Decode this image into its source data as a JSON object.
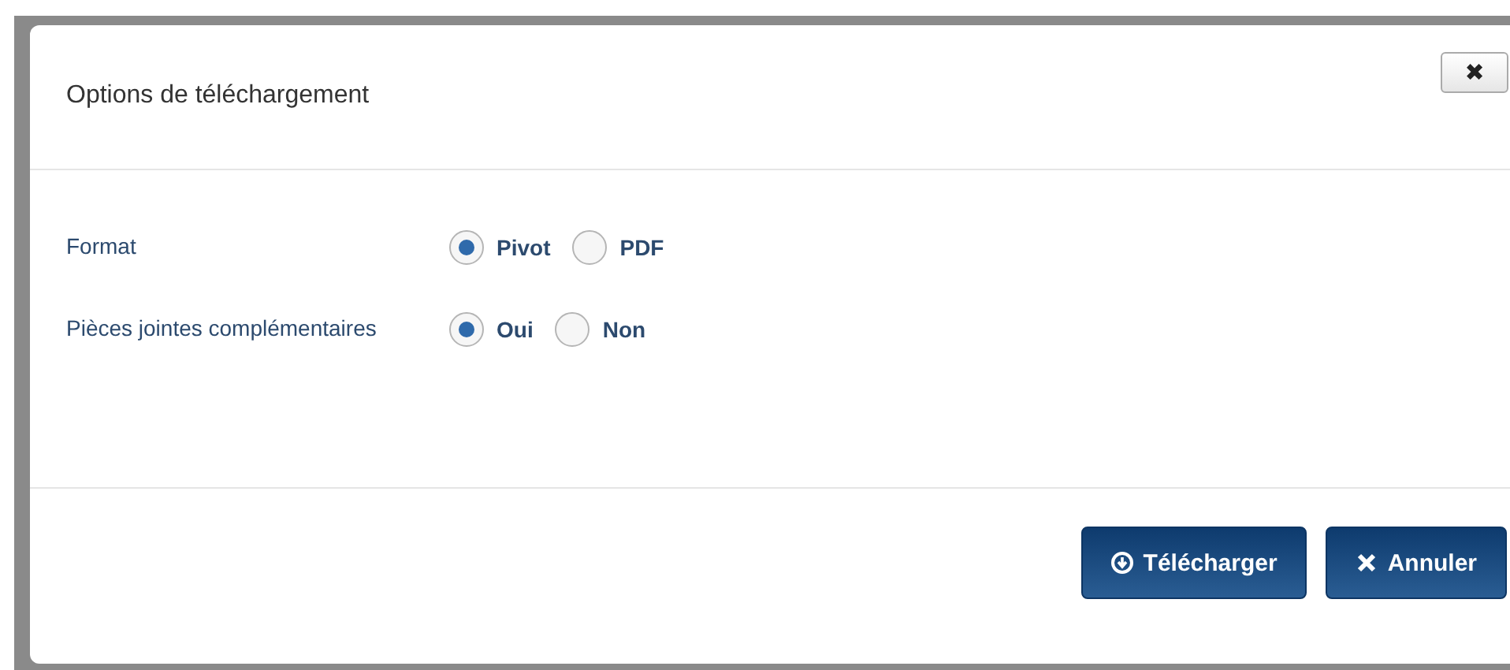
{
  "dialog": {
    "title": "Options de téléchargement",
    "close_label": "✖"
  },
  "fields": [
    {
      "label": "Format",
      "options": [
        {
          "label": "Pivot",
          "selected": true
        },
        {
          "label": "PDF",
          "selected": false
        }
      ]
    },
    {
      "label": "Pièces jointes complémentaires",
      "options": [
        {
          "label": "Oui",
          "selected": true
        },
        {
          "label": "Non",
          "selected": false
        }
      ]
    }
  ],
  "buttons": [
    {
      "kind": "download",
      "label": "Télécharger"
    },
    {
      "kind": "cancel",
      "label": "Annuler"
    }
  ]
}
